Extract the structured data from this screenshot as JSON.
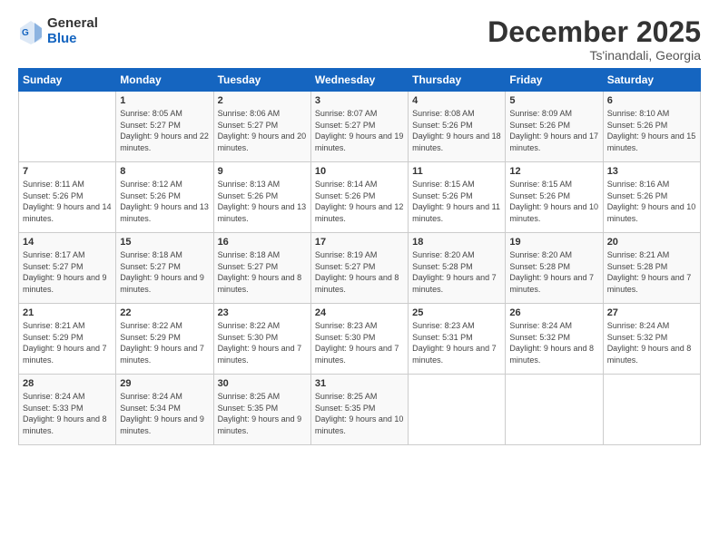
{
  "logo": {
    "general": "General",
    "blue": "Blue"
  },
  "title": "December 2025",
  "location": "Ts'inandali, Georgia",
  "headers": [
    "Sunday",
    "Monday",
    "Tuesday",
    "Wednesday",
    "Thursday",
    "Friday",
    "Saturday"
  ],
  "weeks": [
    [
      {
        "day": "",
        "sunrise": "",
        "sunset": "",
        "daylight": ""
      },
      {
        "day": "1",
        "sunrise": "Sunrise: 8:05 AM",
        "sunset": "Sunset: 5:27 PM",
        "daylight": "Daylight: 9 hours and 22 minutes."
      },
      {
        "day": "2",
        "sunrise": "Sunrise: 8:06 AM",
        "sunset": "Sunset: 5:27 PM",
        "daylight": "Daylight: 9 hours and 20 minutes."
      },
      {
        "day": "3",
        "sunrise": "Sunrise: 8:07 AM",
        "sunset": "Sunset: 5:27 PM",
        "daylight": "Daylight: 9 hours and 19 minutes."
      },
      {
        "day": "4",
        "sunrise": "Sunrise: 8:08 AM",
        "sunset": "Sunset: 5:26 PM",
        "daylight": "Daylight: 9 hours and 18 minutes."
      },
      {
        "day": "5",
        "sunrise": "Sunrise: 8:09 AM",
        "sunset": "Sunset: 5:26 PM",
        "daylight": "Daylight: 9 hours and 17 minutes."
      },
      {
        "day": "6",
        "sunrise": "Sunrise: 8:10 AM",
        "sunset": "Sunset: 5:26 PM",
        "daylight": "Daylight: 9 hours and 15 minutes."
      }
    ],
    [
      {
        "day": "7",
        "sunrise": "Sunrise: 8:11 AM",
        "sunset": "Sunset: 5:26 PM",
        "daylight": "Daylight: 9 hours and 14 minutes."
      },
      {
        "day": "8",
        "sunrise": "Sunrise: 8:12 AM",
        "sunset": "Sunset: 5:26 PM",
        "daylight": "Daylight: 9 hours and 13 minutes."
      },
      {
        "day": "9",
        "sunrise": "Sunrise: 8:13 AM",
        "sunset": "Sunset: 5:26 PM",
        "daylight": "Daylight: 9 hours and 13 minutes."
      },
      {
        "day": "10",
        "sunrise": "Sunrise: 8:14 AM",
        "sunset": "Sunset: 5:26 PM",
        "daylight": "Daylight: 9 hours and 12 minutes."
      },
      {
        "day": "11",
        "sunrise": "Sunrise: 8:15 AM",
        "sunset": "Sunset: 5:26 PM",
        "daylight": "Daylight: 9 hours and 11 minutes."
      },
      {
        "day": "12",
        "sunrise": "Sunrise: 8:15 AM",
        "sunset": "Sunset: 5:26 PM",
        "daylight": "Daylight: 9 hours and 10 minutes."
      },
      {
        "day": "13",
        "sunrise": "Sunrise: 8:16 AM",
        "sunset": "Sunset: 5:26 PM",
        "daylight": "Daylight: 9 hours and 10 minutes."
      }
    ],
    [
      {
        "day": "14",
        "sunrise": "Sunrise: 8:17 AM",
        "sunset": "Sunset: 5:27 PM",
        "daylight": "Daylight: 9 hours and 9 minutes."
      },
      {
        "day": "15",
        "sunrise": "Sunrise: 8:18 AM",
        "sunset": "Sunset: 5:27 PM",
        "daylight": "Daylight: 9 hours and 9 minutes."
      },
      {
        "day": "16",
        "sunrise": "Sunrise: 8:18 AM",
        "sunset": "Sunset: 5:27 PM",
        "daylight": "Daylight: 9 hours and 8 minutes."
      },
      {
        "day": "17",
        "sunrise": "Sunrise: 8:19 AM",
        "sunset": "Sunset: 5:27 PM",
        "daylight": "Daylight: 9 hours and 8 minutes."
      },
      {
        "day": "18",
        "sunrise": "Sunrise: 8:20 AM",
        "sunset": "Sunset: 5:28 PM",
        "daylight": "Daylight: 9 hours and 7 minutes."
      },
      {
        "day": "19",
        "sunrise": "Sunrise: 8:20 AM",
        "sunset": "Sunset: 5:28 PM",
        "daylight": "Daylight: 9 hours and 7 minutes."
      },
      {
        "day": "20",
        "sunrise": "Sunrise: 8:21 AM",
        "sunset": "Sunset: 5:28 PM",
        "daylight": "Daylight: 9 hours and 7 minutes."
      }
    ],
    [
      {
        "day": "21",
        "sunrise": "Sunrise: 8:21 AM",
        "sunset": "Sunset: 5:29 PM",
        "daylight": "Daylight: 9 hours and 7 minutes."
      },
      {
        "day": "22",
        "sunrise": "Sunrise: 8:22 AM",
        "sunset": "Sunset: 5:29 PM",
        "daylight": "Daylight: 9 hours and 7 minutes."
      },
      {
        "day": "23",
        "sunrise": "Sunrise: 8:22 AM",
        "sunset": "Sunset: 5:30 PM",
        "daylight": "Daylight: 9 hours and 7 minutes."
      },
      {
        "day": "24",
        "sunrise": "Sunrise: 8:23 AM",
        "sunset": "Sunset: 5:30 PM",
        "daylight": "Daylight: 9 hours and 7 minutes."
      },
      {
        "day": "25",
        "sunrise": "Sunrise: 8:23 AM",
        "sunset": "Sunset: 5:31 PM",
        "daylight": "Daylight: 9 hours and 7 minutes."
      },
      {
        "day": "26",
        "sunrise": "Sunrise: 8:24 AM",
        "sunset": "Sunset: 5:32 PM",
        "daylight": "Daylight: 9 hours and 8 minutes."
      },
      {
        "day": "27",
        "sunrise": "Sunrise: 8:24 AM",
        "sunset": "Sunset: 5:32 PM",
        "daylight": "Daylight: 9 hours and 8 minutes."
      }
    ],
    [
      {
        "day": "28",
        "sunrise": "Sunrise: 8:24 AM",
        "sunset": "Sunset: 5:33 PM",
        "daylight": "Daylight: 9 hours and 8 minutes."
      },
      {
        "day": "29",
        "sunrise": "Sunrise: 8:24 AM",
        "sunset": "Sunset: 5:34 PM",
        "daylight": "Daylight: 9 hours and 9 minutes."
      },
      {
        "day": "30",
        "sunrise": "Sunrise: 8:25 AM",
        "sunset": "Sunset: 5:35 PM",
        "daylight": "Daylight: 9 hours and 9 minutes."
      },
      {
        "day": "31",
        "sunrise": "Sunrise: 8:25 AM",
        "sunset": "Sunset: 5:35 PM",
        "daylight": "Daylight: 9 hours and 10 minutes."
      },
      {
        "day": "",
        "sunrise": "",
        "sunset": "",
        "daylight": ""
      },
      {
        "day": "",
        "sunrise": "",
        "sunset": "",
        "daylight": ""
      },
      {
        "day": "",
        "sunrise": "",
        "sunset": "",
        "daylight": ""
      }
    ]
  ]
}
